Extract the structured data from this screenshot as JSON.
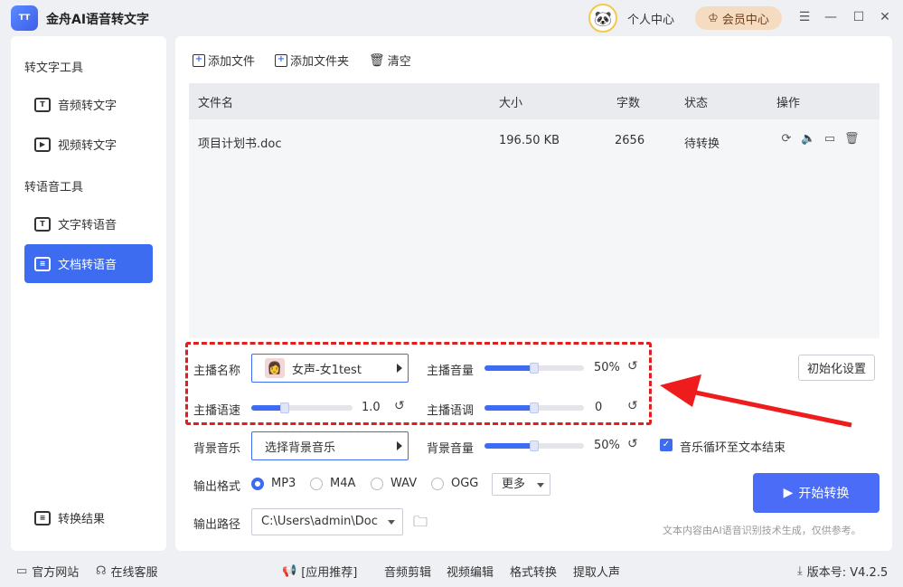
{
  "app": {
    "logo_text": "TT",
    "title": "金舟AI语音转文字"
  },
  "header": {
    "profile_label": "个人中心",
    "vip_label": "会员中心"
  },
  "sidebar": {
    "section1": "转文字工具",
    "section2": "转语音工具",
    "items": [
      {
        "label": "音频转文字",
        "icon": "audio-to-text-icon"
      },
      {
        "label": "视频转文字",
        "icon": "video-to-text-icon"
      },
      {
        "label": "文字转语音",
        "icon": "text-to-speech-icon"
      },
      {
        "label": "文档转语音",
        "icon": "document-to-speech-icon",
        "active": true
      }
    ],
    "results_label": "转换结果"
  },
  "toolbar": {
    "add_file": "添加文件",
    "add_folder": "添加文件夹",
    "clear": "清空"
  },
  "table": {
    "headers": {
      "name": "文件名",
      "size": "大小",
      "chars": "字数",
      "status": "状态",
      "actions": "操作"
    },
    "rows": [
      {
        "name": "项目计划书.doc",
        "size": "196.50 KB",
        "chars": "2656",
        "status": "待转换"
      }
    ]
  },
  "settings": {
    "anchor_label": "主播名称",
    "anchor_value": "女声-女1test",
    "volume_label": "主播音量",
    "volume_value": "50%",
    "volume_level": 0.5,
    "speed_label": "主播语速",
    "speed_value": "1.0",
    "speed_level": 0.33,
    "pitch_label": "主播语调",
    "pitch_value": "0",
    "pitch_level": 0.5,
    "init_label": "初始化设置",
    "bgm_label": "背景音乐",
    "bgm_value": "选择背景音乐",
    "bgm_volume_label": "背景音量",
    "bgm_volume_value": "50%",
    "bgm_volume_level": 0.5,
    "loop_label": "音乐循环至文本结束",
    "format_label": "输出格式",
    "formats": [
      "MP3",
      "M4A",
      "WAV",
      "OGG"
    ],
    "selected_format": "MP3",
    "more_label": "更多",
    "path_label": "输出路径",
    "path_value": "C:\\Users\\admin\\Doc",
    "start_label": "开始转换",
    "disclaimer": "文本内容由AI语音识别技术生成，仅供参考。"
  },
  "footer": {
    "website": "官方网站",
    "support": "在线客服",
    "recommend": "[应用推荐]",
    "links": [
      "音频剪辑",
      "视频编辑",
      "格式转换",
      "提取人声"
    ],
    "version": "版本号:  V4.2.5"
  },
  "colors": {
    "accent": "#3d6cf0",
    "highlight": "#e02020",
    "vip": "#f5dcc0"
  }
}
